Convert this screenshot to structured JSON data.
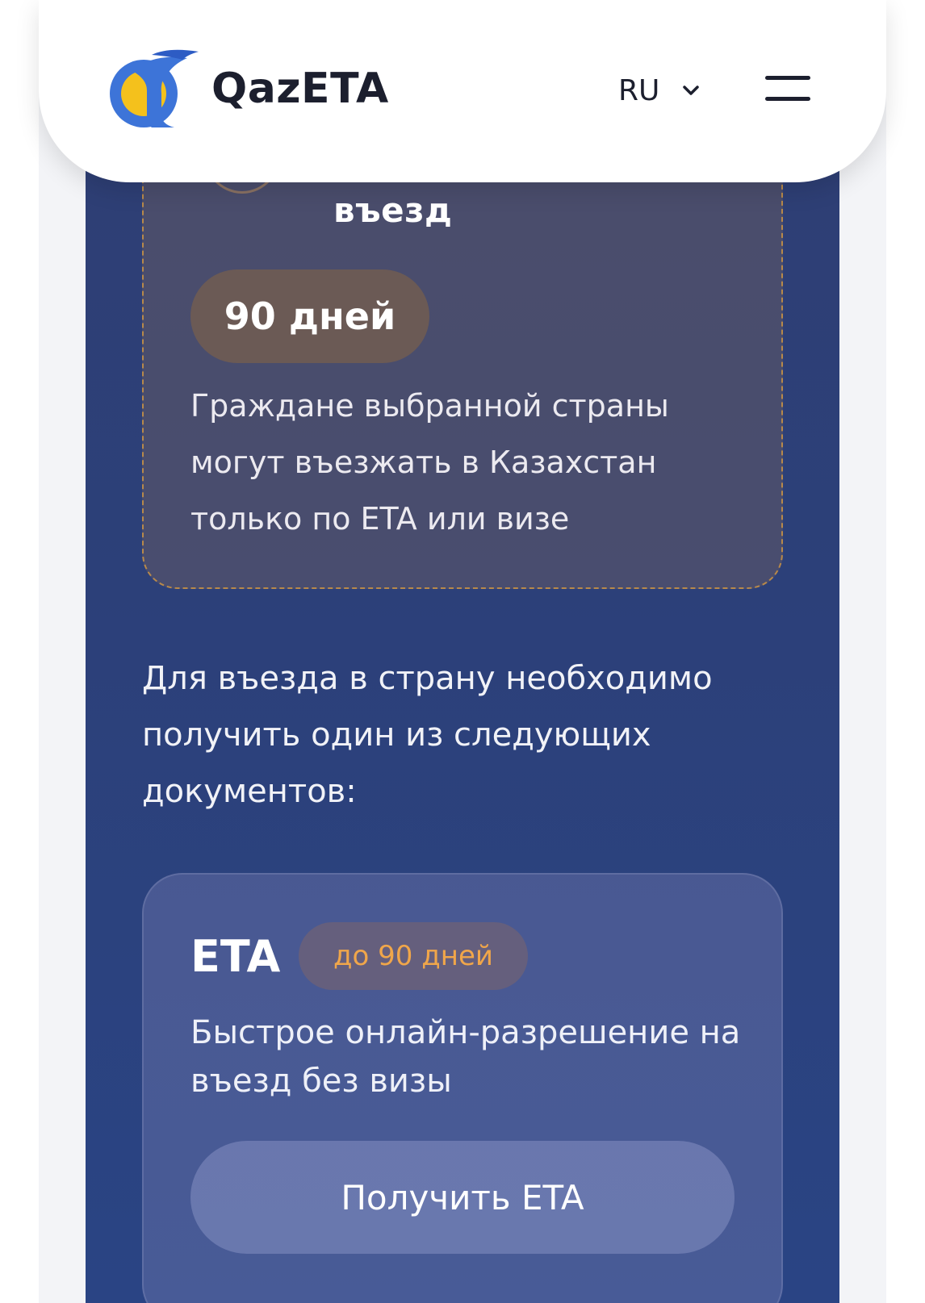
{
  "header": {
    "brand": "QazETA",
    "language": "RU"
  },
  "status_card": {
    "title": "въезд",
    "days_badge": "90 дней",
    "description": "Граждане выбранной страны могут въезжать в Казахстан только по ETA или визе"
  },
  "intro": "Для въезда в страну необходимо получить один из следующих документов:",
  "eta_card": {
    "title": "ETA",
    "badge": "до 90 дней",
    "description": "Быстрое онлайн-разрешение на въезд без визы",
    "button": "Получить ETA"
  },
  "colors": {
    "panel": "#2c4079",
    "accent": "#f0a64a",
    "logo_blue": "#3d74d8",
    "logo_yellow": "#f4c11c"
  },
  "icons": {
    "logo": "qazeta-logo-icon",
    "chevron": "chevron-down-icon",
    "menu": "hamburger-menu-icon"
  }
}
